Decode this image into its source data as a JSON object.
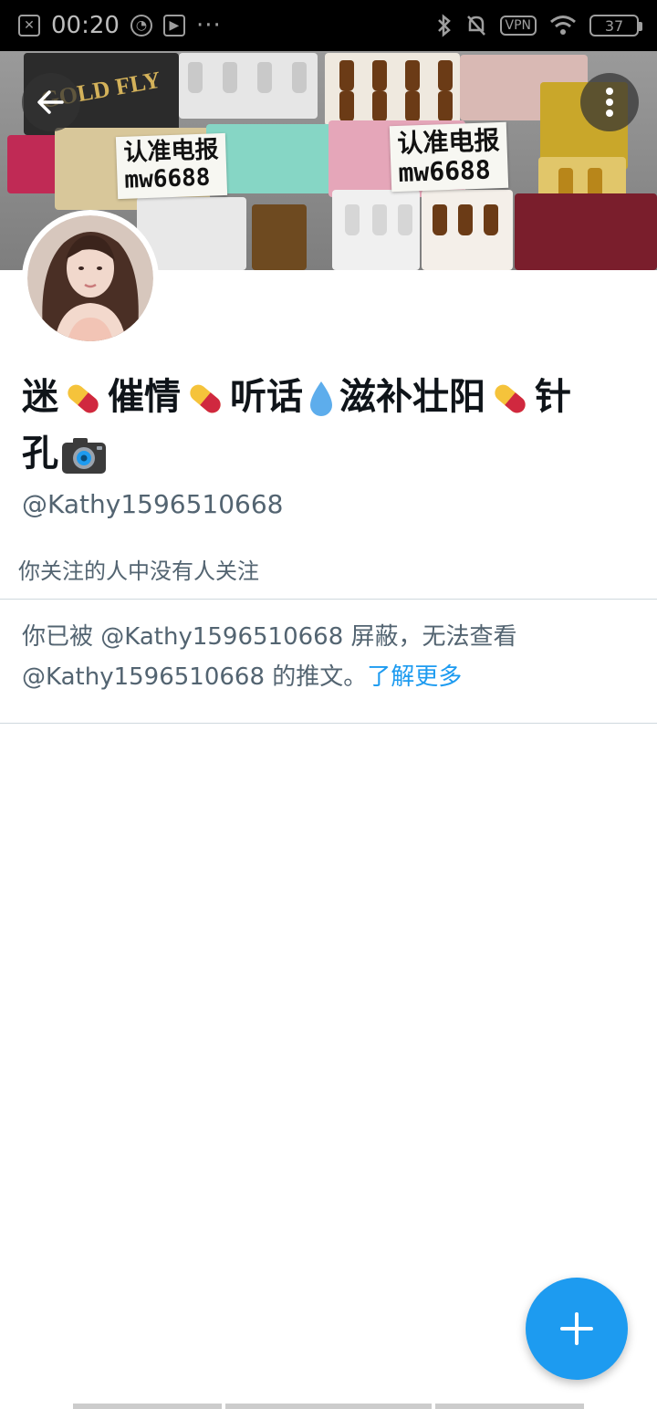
{
  "status_bar": {
    "time": "00:20",
    "vpn": "VPN",
    "battery": "37",
    "more": "···"
  },
  "banner": {
    "note_line1": "认准电报",
    "note_line2": "mw6688",
    "brand_text": "GOLD FLY"
  },
  "profile": {
    "name_parts": [
      "迷",
      "催情",
      "听话",
      "滋补壮阳",
      "针",
      "孔"
    ],
    "handle": "@Kathy1596510668",
    "followers_note": "你关注的人中没有人关注"
  },
  "blocked": {
    "message_part1": "你已被 @Kathy1596510668 屏蔽，无法查看",
    "message_part2": "@Kathy1596510668 的推文。",
    "learn_more": "了解更多"
  },
  "colors": {
    "accent": "#1d9bf0",
    "secondary_text": "#536471",
    "divider": "#cfd9de"
  },
  "icons": {
    "back": "arrow-left",
    "more": "vertical-dots",
    "compose": "plus"
  }
}
